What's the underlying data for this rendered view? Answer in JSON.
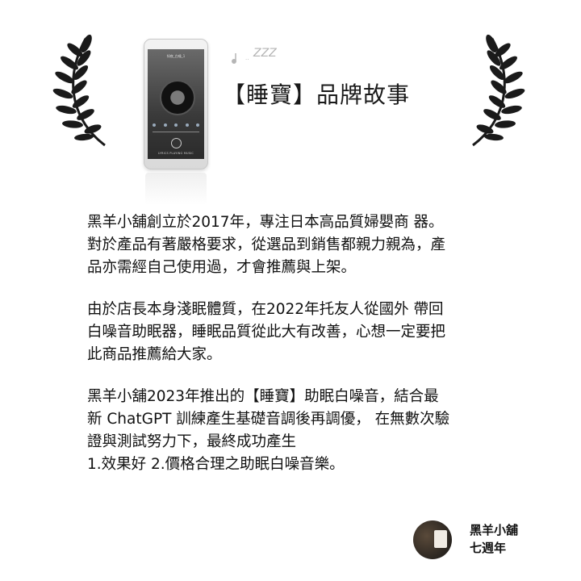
{
  "header": {
    "title": "【睡寶】品牌故事"
  },
  "phone_screen": {
    "song_title": "知夜_白噪_1",
    "lyric_bar": "LYRICS   PLAYING MUSIC"
  },
  "sleep_icon": {
    "zzz": "ZZZ"
  },
  "paragraphs": [
    {
      "lines": [
        "黑羊小舖創立於2017年，專注日本高品質婦嬰商 器。",
        "對於產品有著嚴格要求，從選品到銷售都親力親為，產",
        "品亦需經自己使用過，才會推薦與上架。"
      ]
    },
    {
      "lines": [
        "由於店長本身淺眠體質，在2022年托友人從國外 帶回",
        "白噪音助眠器，睡眠品質從此大有改善，心想一定要把",
        "此商品推薦給大家。"
      ]
    },
    {
      "lines": [
        "黑羊小舖2023年推出的【睡寶】助眠白噪音，結合最",
        "新 ChatGPT 訓練產生基礎音調後再調優， 在無數次驗",
        "證與測試努力下，最終成功產生",
        "1.效果好 2.價格合理之助眠白噪音樂。"
      ]
    }
  ],
  "footer": {
    "shop_name": "黑羊小舖",
    "anniversary": "七週年"
  },
  "icons": {
    "laurel_left": "laurel-branch-icon",
    "laurel_right": "laurel-branch-icon",
    "sleep": "moon-note-zzz-icon"
  },
  "colors": {
    "text": "#111111",
    "laurel": "#1a1a1a",
    "sleep_icon": "#b5b5b5"
  }
}
